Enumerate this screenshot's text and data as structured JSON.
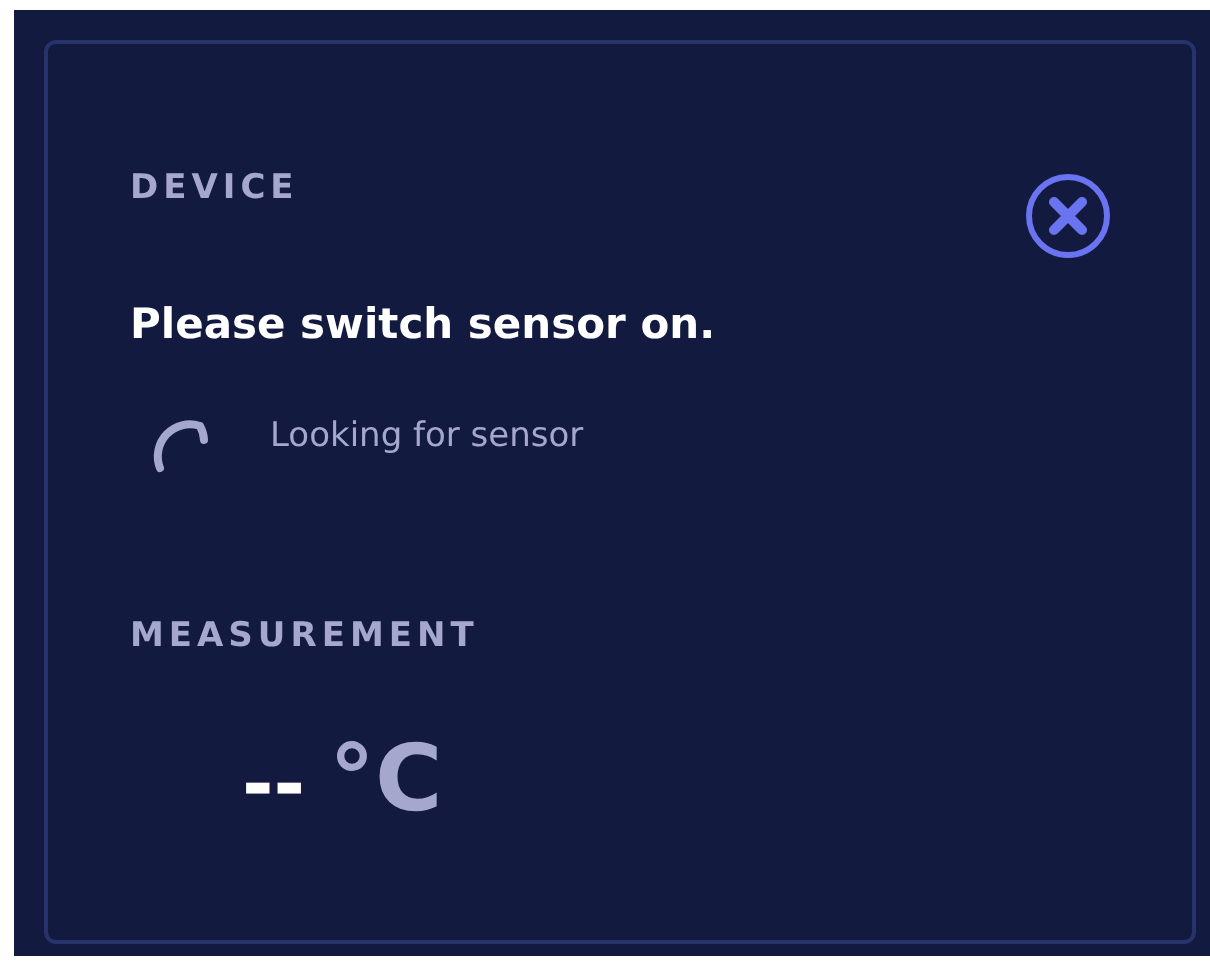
{
  "device": {
    "label": "DEVICE",
    "message": "Please switch sensor on.",
    "status": "Looking for sensor"
  },
  "measurement": {
    "label": "MEASUREMENT",
    "value": "--",
    "unit": "°C"
  }
}
